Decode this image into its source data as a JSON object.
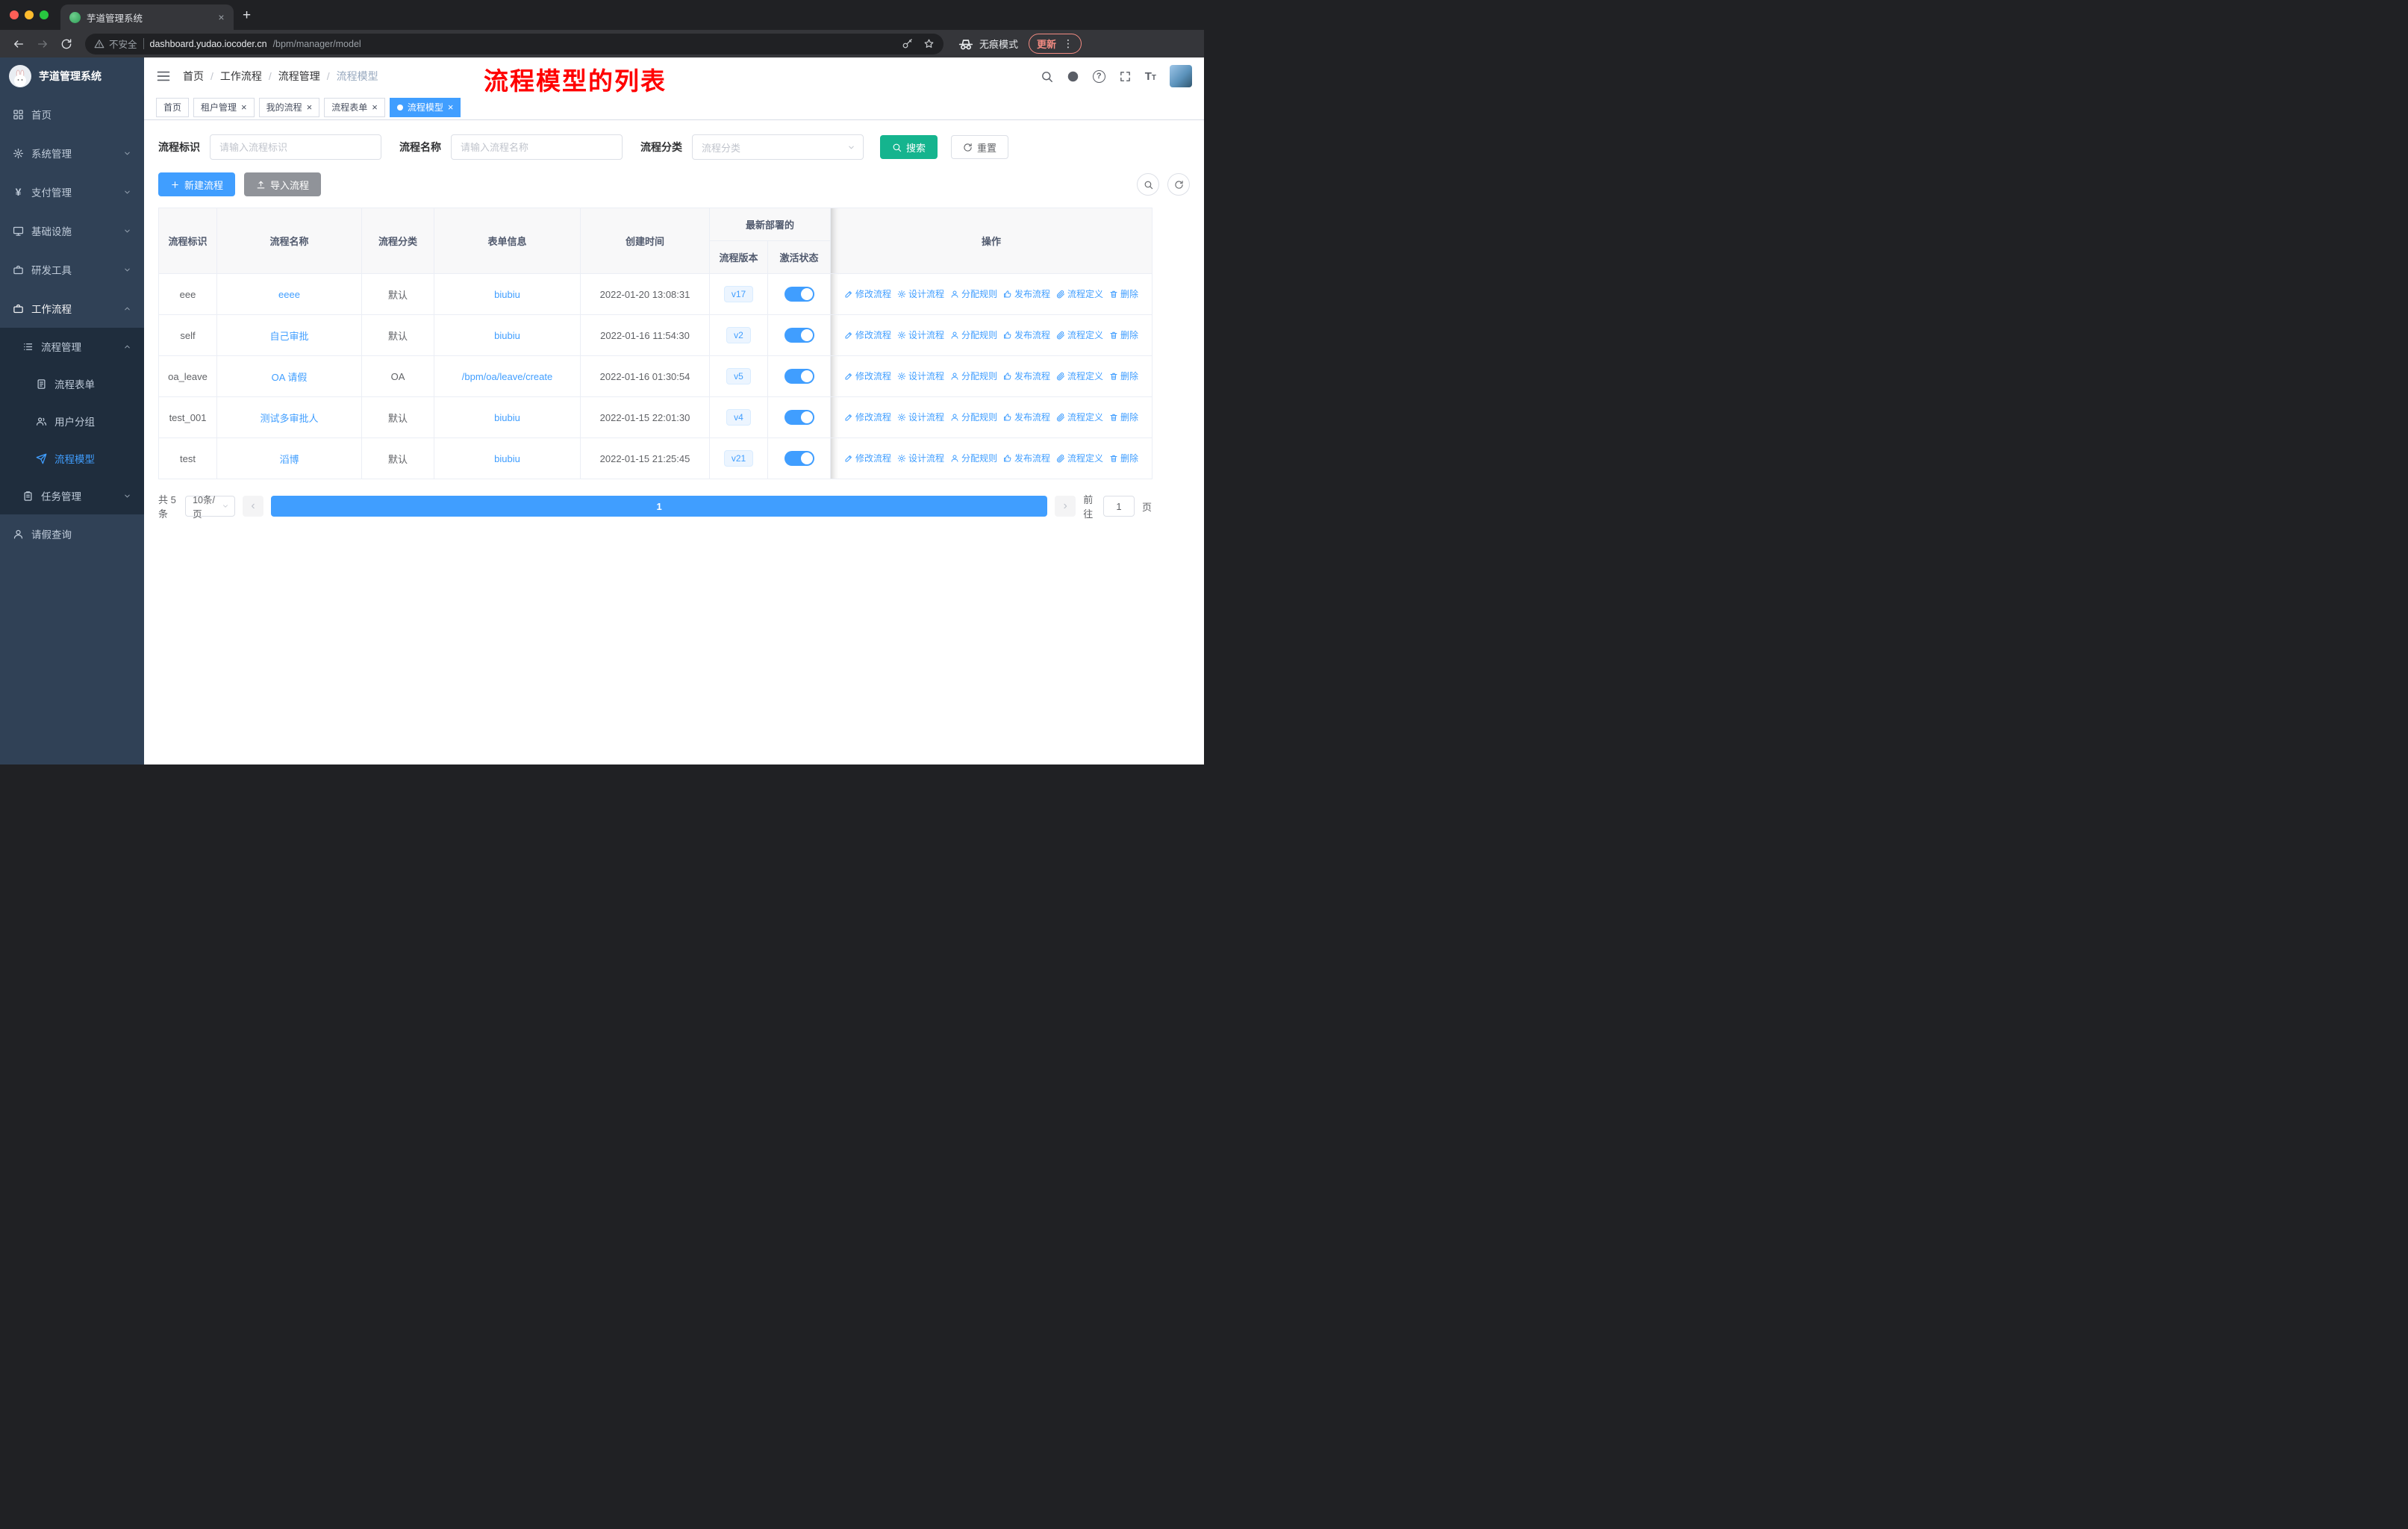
{
  "browser": {
    "tab_title": "芋道管理系统",
    "security_label": "不安全",
    "url_host": "dashboard.yudao.iocoder.cn",
    "url_path": "/bpm/manager/model",
    "incognito_label": "无痕模式",
    "update_label": "更新"
  },
  "icons": {
    "close": "×",
    "plus": "+",
    "more_vertical": "⋮",
    "question": "?",
    "yen": "¥",
    "slash": "/",
    "prev": "‹",
    "next": "›",
    "font_big": "T",
    "font_small": "T"
  },
  "sidebar": {
    "logo_title": "芋道管理系统",
    "items": [
      {
        "label": "首页"
      },
      {
        "label": "系统管理"
      },
      {
        "label": "支付管理"
      },
      {
        "label": "基础设施"
      },
      {
        "label": "研发工具"
      },
      {
        "label": "工作流程"
      }
    ],
    "process_group": "流程管理",
    "process_children": [
      {
        "label": "流程表单"
      },
      {
        "label": "用户分组"
      },
      {
        "label": "流程模型"
      }
    ],
    "task_group": "任务管理",
    "leave_item": "请假查询"
  },
  "header": {
    "breadcrumb": [
      "首页",
      "工作流程",
      "流程管理",
      "流程模型"
    ],
    "annotation": "流程模型的列表"
  },
  "tags": [
    {
      "label": "首页"
    },
    {
      "label": "租户管理"
    },
    {
      "label": "我的流程"
    },
    {
      "label": "流程表单"
    },
    {
      "label": "流程模型"
    }
  ],
  "filters": {
    "id_label": "流程标识",
    "id_placeholder": "请输入流程标识",
    "name_label": "流程名称",
    "name_placeholder": "请输入流程名称",
    "category_label": "流程分类",
    "category_placeholder": "流程分类",
    "search_label": "搜索",
    "reset_label": "重置"
  },
  "toolbar": {
    "create_label": "新建流程",
    "import_label": "导入流程"
  },
  "table": {
    "headers": {
      "id": "流程标识",
      "name": "流程名称",
      "category": "流程分类",
      "form": "表单信息",
      "created": "创建时间",
      "deploy_group": "最新部署的",
      "version": "流程版本",
      "status": "激活状态",
      "ops": "操作"
    },
    "ops": [
      "修改流程",
      "设计流程",
      "分配规则",
      "发布流程",
      "流程定义",
      "删除"
    ],
    "rows": [
      {
        "id": "eee",
        "name": "eeee",
        "category": "默认",
        "form": "biubiu",
        "created": "2022-01-20 13:08:31",
        "version": "v17"
      },
      {
        "id": "self",
        "name": "自己审批",
        "category": "默认",
        "form": "biubiu",
        "created": "2022-01-16 11:54:30",
        "version": "v2"
      },
      {
        "id": "oa_leave",
        "name": "OA 请假",
        "category": "OA",
        "form": "/bpm/oa/leave/create",
        "created": "2022-01-16 01:30:54",
        "version": "v5"
      },
      {
        "id": "test_001",
        "name": "测试多审批人",
        "category": "默认",
        "form": "biubiu",
        "created": "2022-01-15 22:01:30",
        "version": "v4"
      },
      {
        "id": "test",
        "name": "滔博",
        "category": "默认",
        "form": "biubiu",
        "created": "2022-01-15 21:25:45",
        "version": "v21"
      }
    ]
  },
  "pagination": {
    "total_label": "共 5 条",
    "page_size": "10条/页",
    "current_page": "1",
    "goto_label": "前往",
    "goto_value": "1",
    "page_suffix": "页"
  },
  "colors": {
    "primary": "#409eff",
    "search_button": "#15b48e",
    "annotation": "#ff0000",
    "sidebar_bg": "#304156",
    "submenu_bg": "#1f2d3d"
  }
}
